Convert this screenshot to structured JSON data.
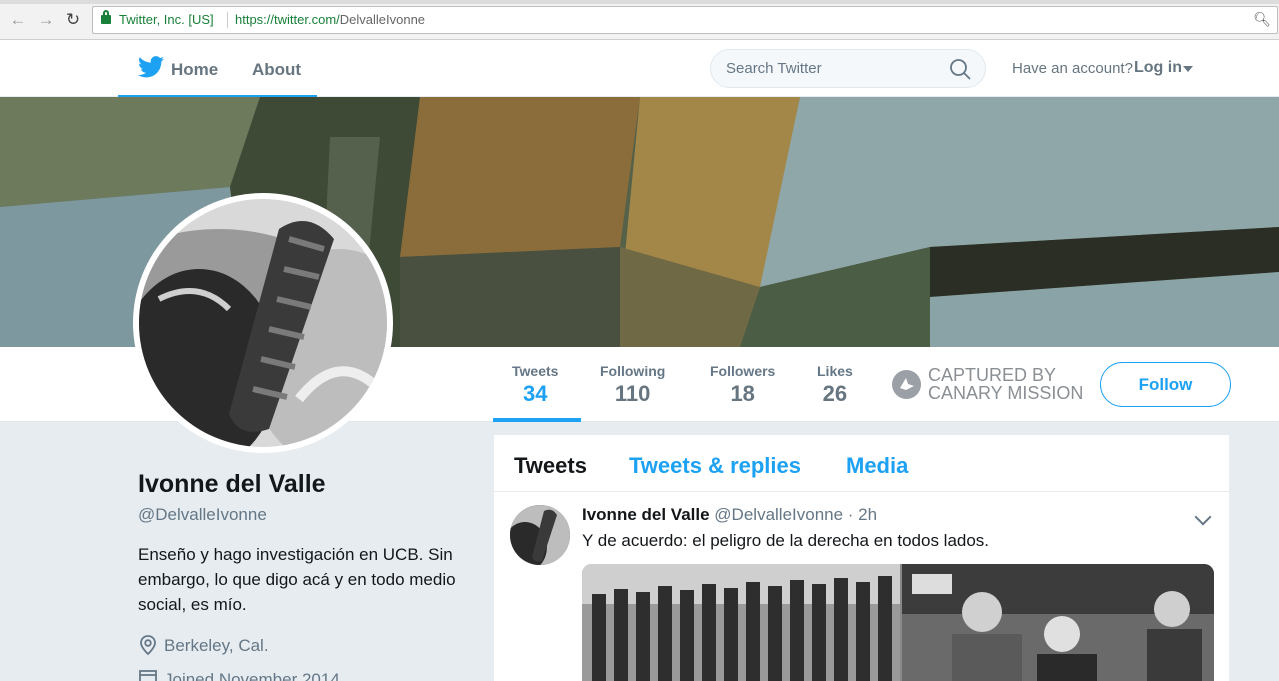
{
  "browser": {
    "ev_label": "Twitter, Inc. [US]",
    "url_scheme_host": "https://twitter.com/",
    "url_path": "DelvalleIvonne"
  },
  "topnav": {
    "home_label": "Home",
    "about_label": "About",
    "search_placeholder": "Search Twitter",
    "account_prompt": "Have an account?",
    "login_label": "Log in"
  },
  "stats": [
    {
      "label": "Tweets",
      "value": "34"
    },
    {
      "label": "Following",
      "value": "110"
    },
    {
      "label": "Followers",
      "value": "18"
    },
    {
      "label": "Likes",
      "value": "26"
    }
  ],
  "canary": {
    "line1": "CAPTURED BY",
    "line2": "CANARY MISSION"
  },
  "follow_label": "Follow",
  "profile": {
    "name": "Ivonne del Valle",
    "handle": "@DelvalleIvonne",
    "bio": "Enseño y hago investigación en UCB. Sin embargo, lo que digo acá y en todo medio social, es mío.",
    "location": "Berkeley, Cal.",
    "joined": "Joined November 2014"
  },
  "timeline": {
    "tabs": [
      "Tweets",
      "Tweets & replies",
      "Media"
    ],
    "tweet": {
      "name": "Ivonne del Valle",
      "handle_time": "@DelvalleIvonne · 2h",
      "text": "Y de acuerdo: el peligro de la derecha en todos lados."
    }
  },
  "colors": {
    "accent": "#1da1f2",
    "ev_green": "#188038"
  }
}
